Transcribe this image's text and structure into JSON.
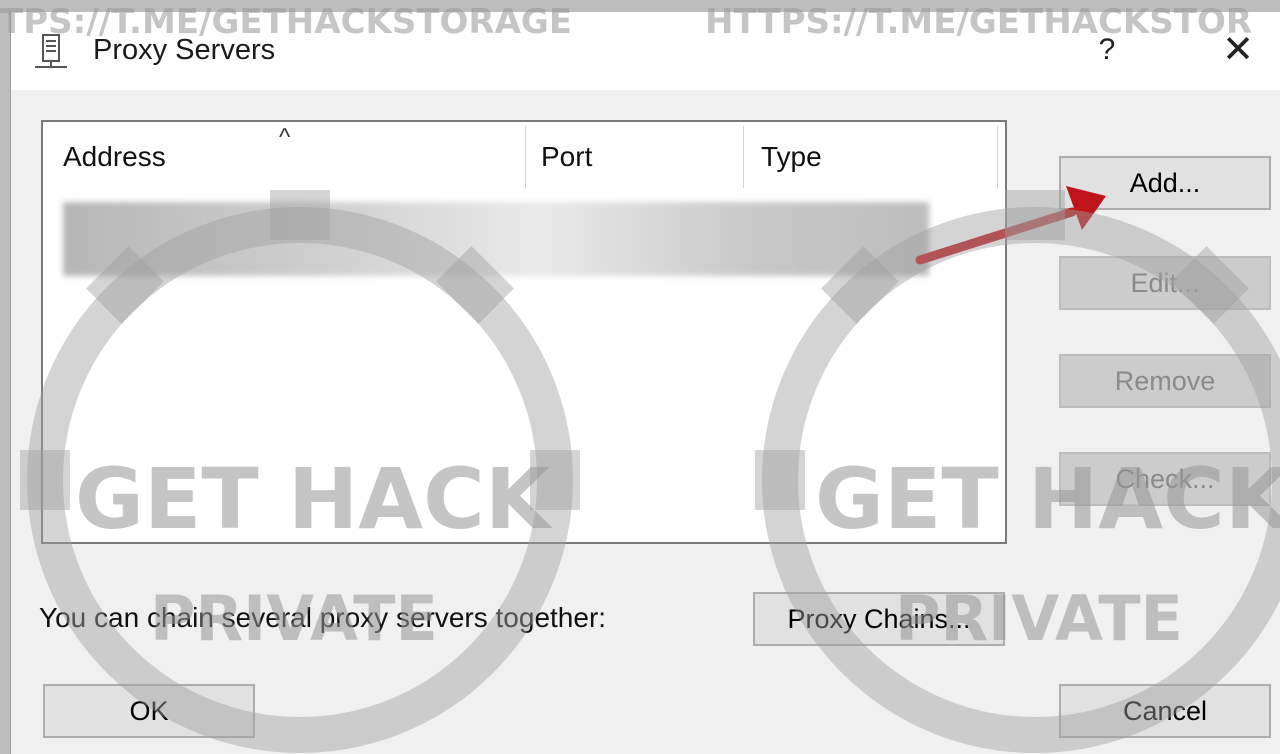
{
  "watermark": {
    "top_banner_left": "TPS://T.ME/GETHACKSTORAGE",
    "top_banner_right": "HTTPS://T.ME/GETHACKSTOR",
    "left_logo_line1": "GET HACK",
    "left_logo_line2": "PRIVATE",
    "right_logo_line1": "GET HACK",
    "right_logo_line2": "PRIVATE"
  },
  "window": {
    "title": "Proxy Servers",
    "icon": "server-icon",
    "help_label": "?",
    "close_label": "✕"
  },
  "table": {
    "columns": [
      "Address",
      "Port",
      "Type"
    ],
    "sort_indicator": "^",
    "rows_visible": 1
  },
  "buttons": {
    "add": "Add...",
    "edit": "Edit...",
    "remove": "Remove",
    "check": "Check...",
    "proxy_chains": "Proxy Chains...",
    "ok": "OK",
    "cancel": "Cancel"
  },
  "chain_text": "You can chain several proxy servers together:",
  "colors": {
    "arrow": "#c0141c",
    "dialog_bg": "#f0f0f0",
    "disabled_text": "#8a8a8a"
  }
}
